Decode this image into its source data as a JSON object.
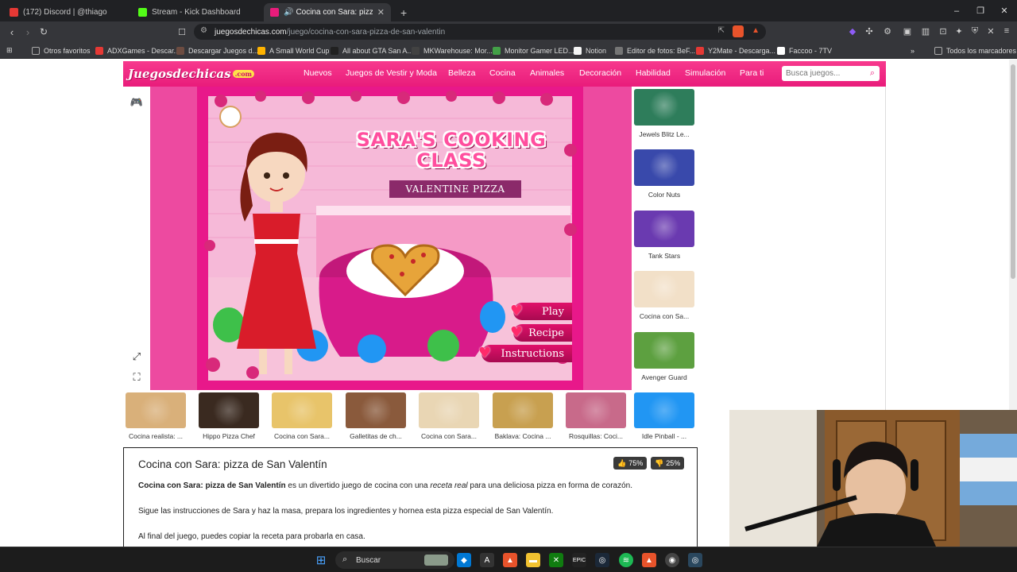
{
  "browser": {
    "tabs": [
      {
        "title": "(172) Discord | @thiago",
        "icon_color": "#e53935"
      },
      {
        "title": "Stream - Kick Dashboard",
        "icon_color": "#53fc18"
      },
      {
        "title": "Cocina con Sara: pizza de San Va",
        "icon_color": "#e91c7b"
      }
    ],
    "new_tab": "+",
    "url_domain": "juegosdechicas.com",
    "url_path": "/juego/cocina-con-sara-pizza-de-san-valentin",
    "bookmarks": [
      {
        "label": "Otros favoritos",
        "icon_color": "#9aa0a6"
      },
      {
        "label": "ADXGames - Descar...",
        "icon_color": "#e53935"
      },
      {
        "label": "Descargar Juegos d...",
        "icon_color": "#6d4c41"
      },
      {
        "label": "A Small World Cup",
        "icon_color": "#ffb300"
      },
      {
        "label": "All about GTA San A...",
        "icon_color": "#212121"
      },
      {
        "label": "MKWarehouse: Mor...",
        "icon_color": "#424242"
      },
      {
        "label": "Monitor Gamer LED...",
        "icon_color": "#43a047"
      },
      {
        "label": "Notion",
        "icon_color": "#f5f5f5"
      },
      {
        "label": "Editor de fotos: BeF...",
        "icon_color": "#757575"
      },
      {
        "label": "Y2Mate - Descarga...",
        "icon_color": "#e53935"
      },
      {
        "label": "Faccoo - 7TV",
        "icon_color": "#ffffff"
      },
      {
        "label": "Todos los marcadores",
        "icon_color": "#9aa0a6"
      }
    ]
  },
  "site": {
    "logo_text": "Juegosdechicas",
    "logo_suffix": ".com",
    "brand_color": "#e91c7b",
    "nav": [
      "Nuevos",
      "Juegos de Vestir y Moda",
      "Belleza",
      "Cocina",
      "Animales",
      "Decoración",
      "Habilidad",
      "Simulación",
      "Para ti"
    ],
    "search_placeholder": "Busca juegos..."
  },
  "game": {
    "title": "SARA'S COOKING CLASS",
    "subtitle": "VALENTINE PIZZA",
    "buttons": [
      "Play",
      "Recipe",
      "Instructions"
    ]
  },
  "side_games": [
    {
      "label": "Jewels Blitz Le...",
      "color": "#2e7d5b"
    },
    {
      "label": "Color Nuts",
      "color": "#3949ab"
    },
    {
      "label": "Tank Stars",
      "color": "#6a3ab0"
    },
    {
      "label": "Cocina con Sa...",
      "color": "#f2e0c8"
    },
    {
      "label": "Avenger Guard",
      "color": "#5da040"
    }
  ],
  "bottom_games": [
    {
      "label": "Cocina realista: ...",
      "color": "#d9b07a"
    },
    {
      "label": "Hippo Pizza Chef",
      "color": "#3a2a20"
    },
    {
      "label": "Cocina con Sara...",
      "color": "#e8c46a"
    },
    {
      "label": "Galletitas de ch...",
      "color": "#8a5a3c"
    },
    {
      "label": "Cocina con Sara...",
      "color": "#e9d6b4"
    },
    {
      "label": "Baklava: Cocina ...",
      "color": "#c8a050"
    },
    {
      "label": "Rosquillas: Coci...",
      "color": "#c86a8a"
    },
    {
      "label": "Idle Pinball - ...",
      "color": "#2196f3"
    }
  ],
  "description": {
    "title": "Cocina con Sara: pizza de San Valentín",
    "likes": "75%",
    "dislikes": "25%",
    "p1_bold": "Cocina con Sara: pizza de San Valentín",
    "p1_text": " es un divertido juego de cocina con una ",
    "p1_italic": "receta real",
    "p1_end": " para una deliciosa pizza en forma de corazón.",
    "p2": "Sigue las instrucciones de Sara y haz la masa, prepara los ingredientes y hornea esta pizza especial de San Valentín.",
    "p3": "Al final del juego, puedes copiar la receta para probarla en casa."
  },
  "taskbar": {
    "search_label": "Buscar"
  }
}
